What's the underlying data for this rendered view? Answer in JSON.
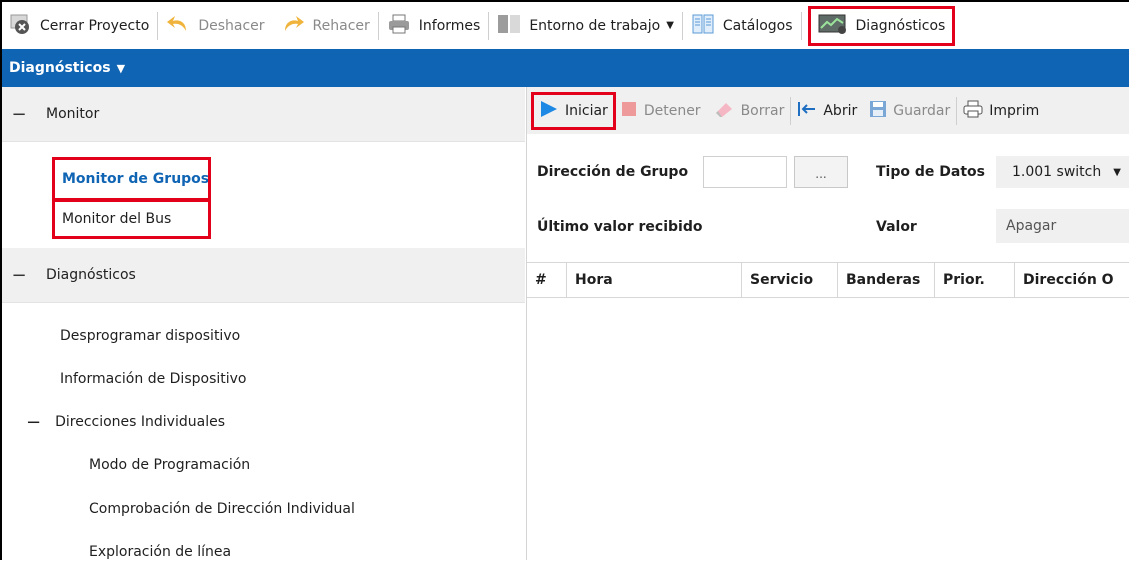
{
  "toolbar": {
    "close_project": "Cerrar Proyecto",
    "undo": "Deshacer",
    "redo": "Rehacer",
    "reports": "Informes",
    "workspace": "Entorno de trabajo",
    "catalogs": "Catálogos",
    "diagnostics": "Diagnósticos"
  },
  "panel_title": "Diagnósticos",
  "sidebar": {
    "groups": [
      {
        "label": "Monitor",
        "items": [
          "Monitor de Grupos",
          "Monitor del Bus"
        ]
      },
      {
        "label": "Diagnósticos",
        "items": [
          "Desprogramar dispositivo",
          "Información de Dispositivo"
        ]
      }
    ],
    "subgroup": {
      "label": "Direcciones Individuales",
      "items": [
        "Modo de Programación",
        "Comprobación de Dirección Individual",
        "Exploración de línea"
      ]
    },
    "selected": "Monitor de Grupos"
  },
  "monitor_toolbar": {
    "start": "Iniciar",
    "stop": "Detener",
    "clear": "Borrar",
    "open": "Abrir",
    "save": "Guardar",
    "print": "Imprim"
  },
  "form": {
    "group_address_label": "Dirección de Grupo",
    "group_address_value": "",
    "browse_label": "...",
    "data_type_label": "Tipo de Datos",
    "data_type_value": "1.001 switch",
    "last_value_label": "Último valor recibido",
    "value_label": "Valor",
    "value_value": "Apagar"
  },
  "table": {
    "columns": [
      "#",
      "Hora",
      "Servicio",
      "Banderas",
      "Prior.",
      "Dirección O"
    ],
    "rows": []
  },
  "colors": {
    "accent": "#0f64b4",
    "highlight": "#e3001b",
    "play": "#1e88e5",
    "stop": "#e57373"
  }
}
